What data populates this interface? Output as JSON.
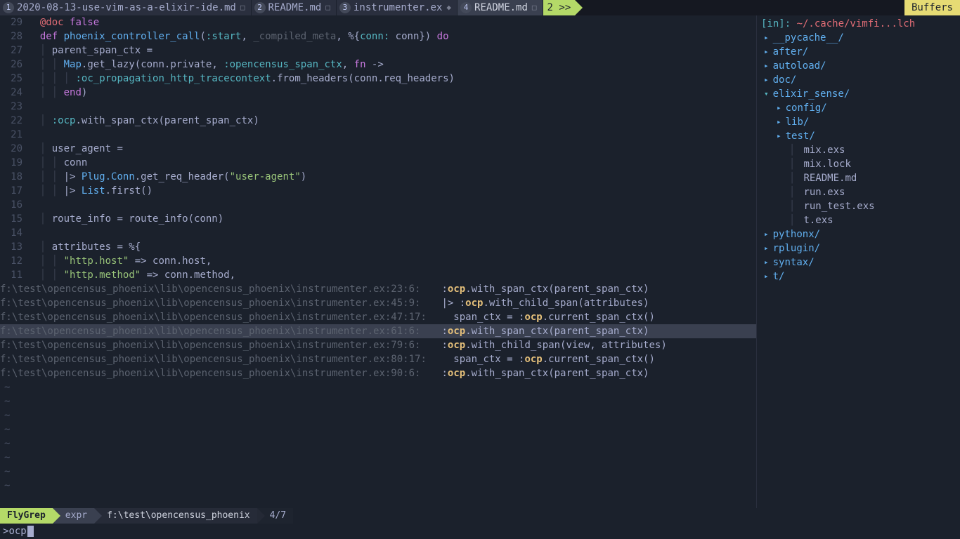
{
  "tabs": [
    {
      "num": "1",
      "label": "2020-08-13-use-vim-as-a-elixir-ide.md",
      "mod": "□"
    },
    {
      "num": "2",
      "label": "README.md",
      "mod": "□"
    },
    {
      "num": "3",
      "label": "instrumenter.ex",
      "mod": "◆"
    },
    {
      "num": "4",
      "label": "README.md",
      "mod": "□"
    }
  ],
  "tabs_more": " 2 >>",
  "buffers_label": "Buffers",
  "gutter": [
    "29",
    "28",
    "27",
    "26",
    "25",
    "24",
    "23",
    "22",
    "21",
    "20",
    "19",
    "18",
    "17",
    "16",
    "15",
    "14",
    "13",
    "12",
    "11"
  ],
  "code_lines": [
    {
      "html": "  <span class='attr'>@doc</span> <span class='kw'>false</span>"
    },
    {
      "html": "  <span class='kw'>def</span> <span class='def'>phoenix_controller_call</span>(<span class='atom'>:start</span>, <span class='dim'>_compiled_meta</span>, %{<span class='atom'>conn:</span> conn}) <span class='kw'>do</span>"
    },
    {
      "html": "  <span class='guide'>│</span> parent_span_ctx ="
    },
    {
      "html": "  <span class='guide'>│</span> <span class='guide'>│</span> <span class='fn'>Map</span>.get_lazy(conn.private, <span class='atom'>:opencensus_span_ctx</span>, <span class='kw'>fn</span> -&gt;"
    },
    {
      "html": "  <span class='guide'>│</span> <span class='guide'>│</span> <span class='guide'>│</span> <span class='atom'>:oc_propagation_http_tracecontext</span>.from_headers(conn.req_headers)"
    },
    {
      "html": "  <span class='guide'>│</span> <span class='guide'>│</span> <span class='kw'>end</span>)"
    },
    {
      "html": ""
    },
    {
      "html": "  <span class='guide'>│</span> <span class='atom'>:ocp</span>.with_span_ctx(parent_span_ctx)"
    },
    {
      "html": ""
    },
    {
      "html": "  <span class='guide'>│</span> user_agent ="
    },
    {
      "html": "  <span class='guide'>│</span> <span class='guide'>│</span> conn"
    },
    {
      "html": "  <span class='guide'>│</span> <span class='guide'>│</span> |&gt; <span class='fn'>Plug.Conn</span>.get_req_header(<span class='str'>\"user-agent\"</span>)"
    },
    {
      "html": "  <span class='guide'>│</span> <span class='guide'>│</span> |&gt; <span class='fn'>List</span>.first()"
    },
    {
      "html": ""
    },
    {
      "html": "  <span class='guide'>│</span> route_info = route_info(conn)"
    },
    {
      "html": ""
    },
    {
      "html": "  <span class='guide'>│</span> attributes = %{"
    },
    {
      "html": "  <span class='guide'>│</span> <span class='guide'>│</span> <span class='str'>\"http.host\"</span> =&gt; conn.host,"
    },
    {
      "html": "  <span class='guide'>│</span> <span class='guide'>│</span> <span class='str'>\"http.method\"</span> =&gt; conn.method,"
    }
  ],
  "grep": [
    {
      "path": "f:\\test\\opencensus_phoenix\\lib\\opencensus_phoenix\\instrumenter.ex",
      "loc": "23:6:",
      "text": ":<b>ocp</b>.with_span_ctx(parent_span_ctx)",
      "selected": false
    },
    {
      "path": "f:\\test\\opencensus_phoenix\\lib\\opencensus_phoenix\\instrumenter.ex",
      "loc": "45:9:",
      "text": "|> :<b>ocp</b>.with_child_span(attributes)",
      "selected": false
    },
    {
      "path": "f:\\test\\opencensus_phoenix\\lib\\opencensus_phoenix\\instrumenter.ex",
      "loc": "47:17:",
      "text": " span_ctx = :<b>ocp</b>.current_span_ctx()",
      "selected": false
    },
    {
      "path": "f:\\test\\opencensus_phoenix\\lib\\opencensus_phoenix\\instrumenter.ex",
      "loc": "61:6:",
      "text": ":<b>ocp</b>.with_span_ctx(parent_span_ctx)",
      "selected": true
    },
    {
      "path": "f:\\test\\opencensus_phoenix\\lib\\opencensus_phoenix\\instrumenter.ex",
      "loc": "79:6:",
      "text": ":<b>ocp</b>.with_child_span(view, attributes)",
      "selected": false
    },
    {
      "path": "f:\\test\\opencensus_phoenix\\lib\\opencensus_phoenix\\instrumenter.ex",
      "loc": "80:17:",
      "text": " span_ctx = :<b>ocp</b>.current_span_ctx()",
      "selected": false
    },
    {
      "path": "f:\\test\\opencensus_phoenix\\lib\\opencensus_phoenix\\instrumenter.ex",
      "loc": "90:6:",
      "text": ":<b>ocp</b>.with_span_ctx(parent_span_ctx)",
      "selected": false
    }
  ],
  "tilde_count": 8,
  "sidebar": {
    "header_in": "[in]: ",
    "header_path": "~/.cache/vimfi...lch",
    "tree": [
      {
        "indent": 0,
        "type": "dir",
        "label": "__pycache__/",
        "expanded": false
      },
      {
        "indent": 0,
        "type": "dir",
        "label": "after/",
        "expanded": false
      },
      {
        "indent": 0,
        "type": "dir",
        "label": "autoload/",
        "expanded": false
      },
      {
        "indent": 0,
        "type": "dir",
        "label": "doc/",
        "expanded": false
      },
      {
        "indent": 0,
        "type": "dir",
        "label": "elixir_sense/",
        "expanded": true
      },
      {
        "indent": 1,
        "type": "dir",
        "label": "config/",
        "expanded": false
      },
      {
        "indent": 1,
        "type": "dir",
        "label": "lib/",
        "expanded": false
      },
      {
        "indent": 1,
        "type": "dir",
        "label": "test/",
        "expanded": false
      },
      {
        "indent": 2,
        "type": "file",
        "label": "mix.exs"
      },
      {
        "indent": 2,
        "type": "file",
        "label": "mix.lock"
      },
      {
        "indent": 2,
        "type": "file",
        "label": "README.md"
      },
      {
        "indent": 2,
        "type": "file",
        "label": "run.exs"
      },
      {
        "indent": 2,
        "type": "file",
        "label": "run_test.exs"
      },
      {
        "indent": 2,
        "type": "file",
        "label": "t.exs"
      },
      {
        "indent": 0,
        "type": "dir",
        "label": "pythonx/",
        "expanded": false
      },
      {
        "indent": 0,
        "type": "dir",
        "label": "rplugin/",
        "expanded": false
      },
      {
        "indent": 0,
        "type": "dir",
        "label": "syntax/",
        "expanded": false
      },
      {
        "indent": 0,
        "type": "dir",
        "label": "t/",
        "expanded": false
      }
    ]
  },
  "status": {
    "mode": "FlyGrep",
    "expr": "expr",
    "path": "f:\\test\\opencensus_phoenix",
    "count": "4/7"
  },
  "cmdline_prompt": "> ",
  "cmdline_text": "ocp"
}
